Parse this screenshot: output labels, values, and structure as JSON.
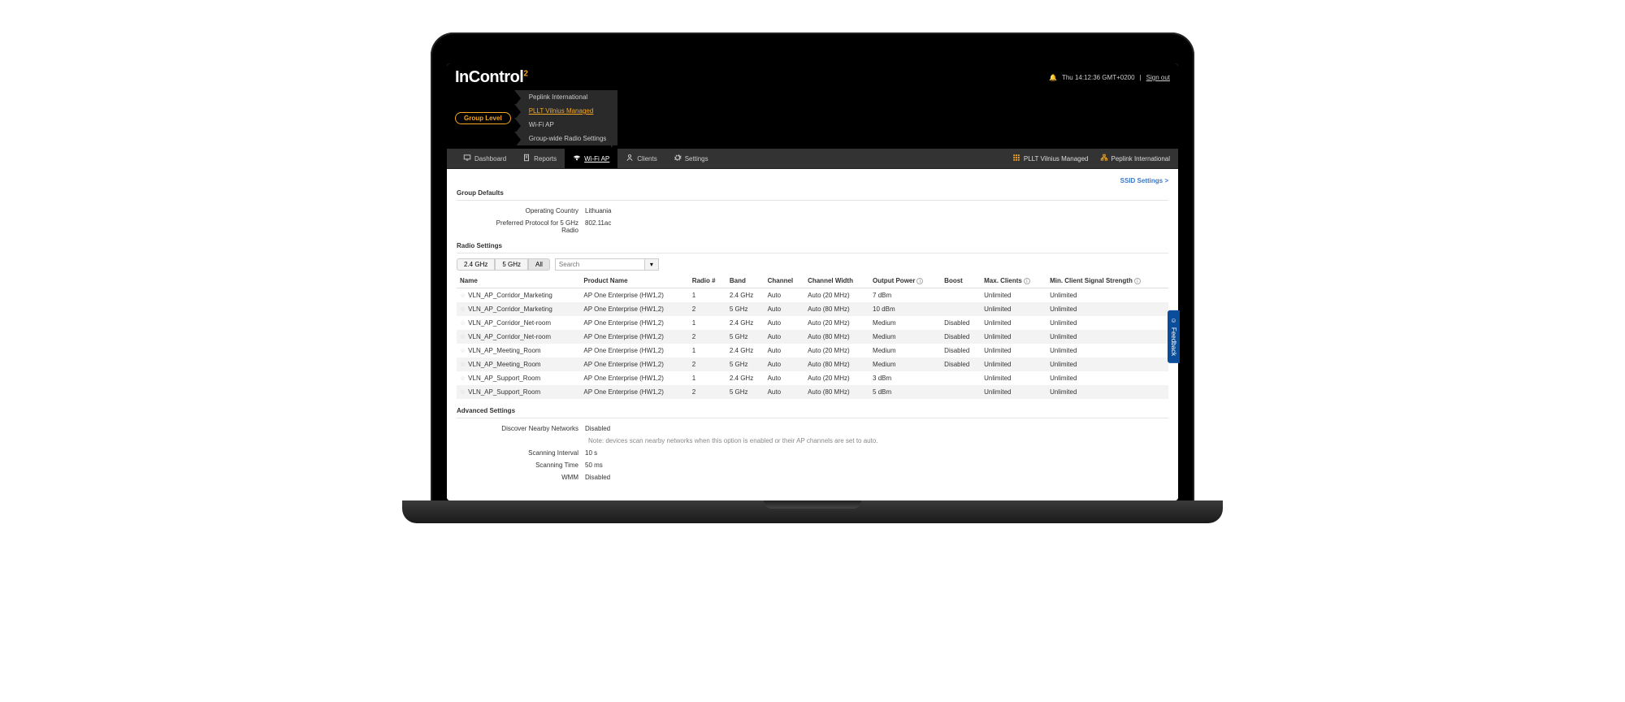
{
  "brand": "InControl",
  "brand_sup": "2",
  "header": {
    "timestamp": "Thu 14:12:36 GMT+0200",
    "signout": "Sign out"
  },
  "breadcrumb": {
    "level_pill": "Group Level",
    "items": [
      {
        "label": "Peplink International",
        "active": false
      },
      {
        "label": "PLLT Vilnius Managed",
        "active": true
      },
      {
        "label": "Wi-Fi AP",
        "active": false
      },
      {
        "label": "Group-wide Radio Settings",
        "active": false
      }
    ]
  },
  "nav": {
    "tabs": [
      {
        "label": "Dashboard",
        "icon": "monitor"
      },
      {
        "label": "Reports",
        "icon": "doc"
      },
      {
        "label": "Wi-Fi AP",
        "icon": "wifi",
        "active": true
      },
      {
        "label": "Clients",
        "icon": "person"
      },
      {
        "label": "Settings",
        "icon": "gear"
      }
    ],
    "right": [
      {
        "label": "PLLT Vilnius Managed",
        "icon": "grid"
      },
      {
        "label": "Peplink International",
        "icon": "org"
      }
    ]
  },
  "ssid_link": "SSID Settings >",
  "group_defaults": {
    "title": "Group Defaults",
    "items": [
      {
        "k": "Operating Country",
        "v": "Lithuania"
      },
      {
        "k": "Preferred Protocol for 5 GHz Radio",
        "v": "802.11ac"
      }
    ]
  },
  "radio_settings": {
    "title": "Radio Settings",
    "filters": [
      "2.4 GHz",
      "5 GHz",
      "All"
    ],
    "active_filter": 2,
    "search_placeholder": "Search",
    "dropdown_glyph": "▾",
    "columns": [
      "Name",
      "Product Name",
      "Radio #",
      "Band",
      "Channel",
      "Channel Width",
      "Output Power",
      "Boost",
      "Max. Clients",
      "Min. Client Signal Strength"
    ],
    "info_cols": [
      6,
      8,
      9
    ],
    "rows": [
      {
        "name": "VLN_AP_Corridor_Marketing",
        "product": "AP One Enterprise (HW1,2)",
        "radio": "1",
        "band": "2.4 GHz",
        "channel": "Auto",
        "width": "Auto (20 MHz)",
        "power": "7 dBm",
        "boost": "",
        "max": "Unlimited",
        "min": "Unlimited"
      },
      {
        "name": "VLN_AP_Corridor_Marketing",
        "product": "AP One Enterprise (HW1,2)",
        "radio": "2",
        "band": "5 GHz",
        "channel": "Auto",
        "width": "Auto (80 MHz)",
        "power": "10 dBm",
        "boost": "",
        "max": "Unlimited",
        "min": "Unlimited"
      },
      {
        "name": "VLN_AP_Corridor_Net-room",
        "product": "AP One Enterprise (HW1,2)",
        "radio": "1",
        "band": "2.4 GHz",
        "channel": "Auto",
        "width": "Auto (20 MHz)",
        "power": "Medium",
        "boost": "Disabled",
        "max": "Unlimited",
        "min": "Unlimited"
      },
      {
        "name": "VLN_AP_Corridor_Net-room",
        "product": "AP One Enterprise (HW1,2)",
        "radio": "2",
        "band": "5 GHz",
        "channel": "Auto",
        "width": "Auto (80 MHz)",
        "power": "Medium",
        "boost": "Disabled",
        "max": "Unlimited",
        "min": "Unlimited"
      },
      {
        "name": "VLN_AP_Meeting_Room",
        "product": "AP One Enterprise (HW1,2)",
        "radio": "1",
        "band": "2.4 GHz",
        "channel": "Auto",
        "width": "Auto (20 MHz)",
        "power": "Medium",
        "boost": "Disabled",
        "max": "Unlimited",
        "min": "Unlimited"
      },
      {
        "name": "VLN_AP_Meeting_Room",
        "product": "AP One Enterprise (HW1,2)",
        "radio": "2",
        "band": "5 GHz",
        "channel": "Auto",
        "width": "Auto (80 MHz)",
        "power": "Medium",
        "boost": "Disabled",
        "max": "Unlimited",
        "min": "Unlimited"
      },
      {
        "name": "VLN_AP_Support_Room",
        "product": "AP One Enterprise (HW1,2)",
        "radio": "1",
        "band": "2.4 GHz",
        "channel": "Auto",
        "width": "Auto (20 MHz)",
        "power": "3 dBm",
        "boost": "",
        "max": "Unlimited",
        "min": "Unlimited"
      },
      {
        "name": "VLN_AP_Support_Room",
        "product": "AP One Enterprise (HW1,2)",
        "radio": "2",
        "band": "5 GHz",
        "channel": "Auto",
        "width": "Auto (80 MHz)",
        "power": "5 dBm",
        "boost": "",
        "max": "Unlimited",
        "min": "Unlimited"
      }
    ]
  },
  "advanced": {
    "title": "Advanced Settings",
    "items": [
      {
        "k": "Discover Nearby Networks",
        "v": "Disabled",
        "note": "Note: devices scan nearby networks when this option is enabled or their AP channels are set to auto."
      },
      {
        "k": "Scanning Interval",
        "v": "10 s"
      },
      {
        "k": "Scanning Time",
        "v": "50 ms"
      },
      {
        "k": "WMM",
        "v": "Disabled"
      }
    ]
  },
  "feedback": "Feedback"
}
